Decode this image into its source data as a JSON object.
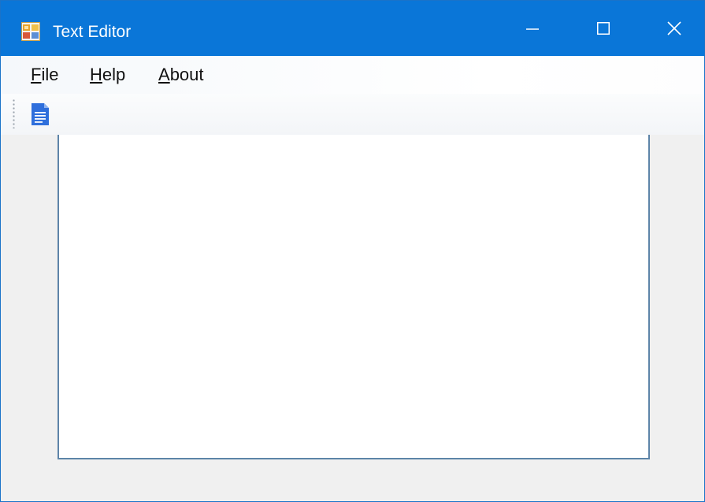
{
  "window": {
    "title": "Text Editor",
    "icon": "app-form-icon",
    "accent": "#0a76d8"
  },
  "titlebar_buttons": {
    "minimize_icon": "minimize-icon",
    "maximize_icon": "maximize-icon",
    "close_icon": "close-icon"
  },
  "menu": {
    "file": {
      "mnemonic": "F",
      "rest": "ile"
    },
    "help": {
      "mnemonic": "H",
      "rest": "elp"
    },
    "about": {
      "mnemonic": "A",
      "rest": "bout"
    }
  },
  "toolbar": {
    "items": [
      {
        "icon": "document-icon",
        "color": "#2f6fdc"
      }
    ]
  },
  "editor": {
    "value": ""
  }
}
